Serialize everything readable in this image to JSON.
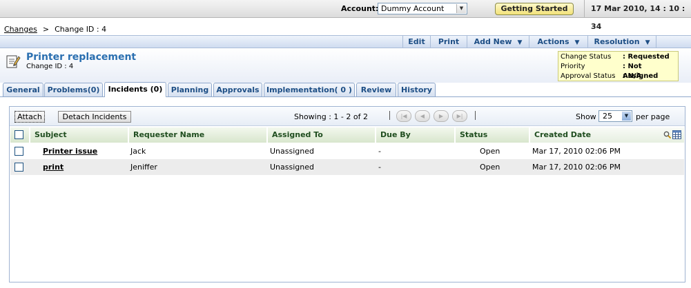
{
  "topbar": {
    "account_label": "Account:",
    "account_value": "Dummy Account",
    "getting_started": "Getting Started",
    "datetime": "17 Mar 2010, 14 : 10 : 34"
  },
  "breadcrumb": {
    "root": "Changes",
    "separator": ">",
    "current": "Change ID : 4"
  },
  "actions": {
    "edit": "Edit",
    "print": "Print",
    "add_new": "Add New",
    "actions": "Actions",
    "resolution": "Resolution"
  },
  "header": {
    "title": "Printer replacement",
    "subtitle": "Change ID : 4",
    "status": [
      {
        "key": "Change Status",
        "value": ": Requested"
      },
      {
        "key": "Priority",
        "value": ": Not Assigned"
      },
      {
        "key": "Approval Status",
        "value": ": N/A"
      }
    ]
  },
  "tabs": [
    "General",
    "Problems(0)",
    "Incidents (0)",
    "Planning",
    "Approvals",
    "Implementation( 0 )",
    "Review",
    "History"
  ],
  "active_tab": "Incidents (0)",
  "toolbar": {
    "attach": "Attach",
    "detach": "Detach Incidents",
    "showing": "Showing : 1 - 2 of 2",
    "show_label": "Show",
    "per_page_value": "25",
    "per_page_label": "per page"
  },
  "table": {
    "columns": [
      "Subject",
      "Requester Name",
      "Assigned To",
      "Due By",
      "Status",
      "Created Date"
    ],
    "rows": [
      {
        "subject": "Printer issue",
        "requester": "Jack",
        "assigned": "Unassigned",
        "due": "-",
        "status": "Open",
        "created": "Mar 17, 2010 02:06 PM"
      },
      {
        "subject": "print",
        "requester": "Jeniffer",
        "assigned": "Unassigned",
        "due": "-",
        "status": "Open",
        "created": "Mar 17, 2010 02:06 PM"
      }
    ]
  },
  "colors": {
    "accent": "#1d4e85",
    "title": "#2a6fb0",
    "header_green": "#1f4d1f",
    "status_bg": "#ffffcc"
  }
}
